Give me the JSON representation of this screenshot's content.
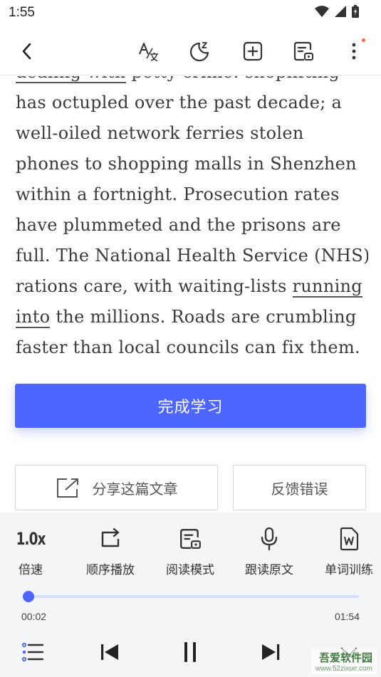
{
  "status": {
    "time": "1:55"
  },
  "article": {
    "lines": [
      [
        {
          "t": "dealing with",
          "u": true
        },
        {
          "t": " petty crime: shoplifting",
          "u": false
        }
      ],
      [
        {
          "t": "has octupled over the past decade; a",
          "u": false
        }
      ],
      [
        {
          "t": "well-oiled network ferries stolen",
          "u": false
        }
      ],
      [
        {
          "t": "phones to shopping malls in Shenzhen",
          "u": false
        }
      ],
      [
        {
          "t": "within a fortnight. Prosecution rates",
          "u": false
        }
      ],
      [
        {
          "t": "have plummeted and the prisons are",
          "u": false
        }
      ],
      [
        {
          "t": "full. The National Health Service (NHS)",
          "u": false
        }
      ],
      [
        {
          "t": "rations care, with waiting-lists ",
          "u": false
        },
        {
          "t": "running",
          "u": true
        }
      ],
      [
        {
          "t": "into",
          "u": true
        },
        {
          "t": " the millions. Roads are crumbling",
          "u": false
        }
      ],
      [
        {
          "t": "faster than local councils can fix them.",
          "u": false
        }
      ]
    ]
  },
  "actions": {
    "complete_label": "完成学习",
    "share_label": "分享这篇文章",
    "feedback_label": "反馈错误"
  },
  "player": {
    "speed_value": "1.0x",
    "speed_label": "倍速",
    "order_label": "顺序播放",
    "read_mode_label": "阅读模式",
    "follow_read_label": "跟读原文",
    "word_training_label": "单词训练",
    "current_time": "00:02",
    "total_time": "01:54",
    "progress": 0.017
  },
  "watermark": {
    "title": "吾爱软件园",
    "url": "www.52zixue.com"
  },
  "colors": {
    "accent": "#4d66ff",
    "player_bg": "#f4f5f7"
  }
}
